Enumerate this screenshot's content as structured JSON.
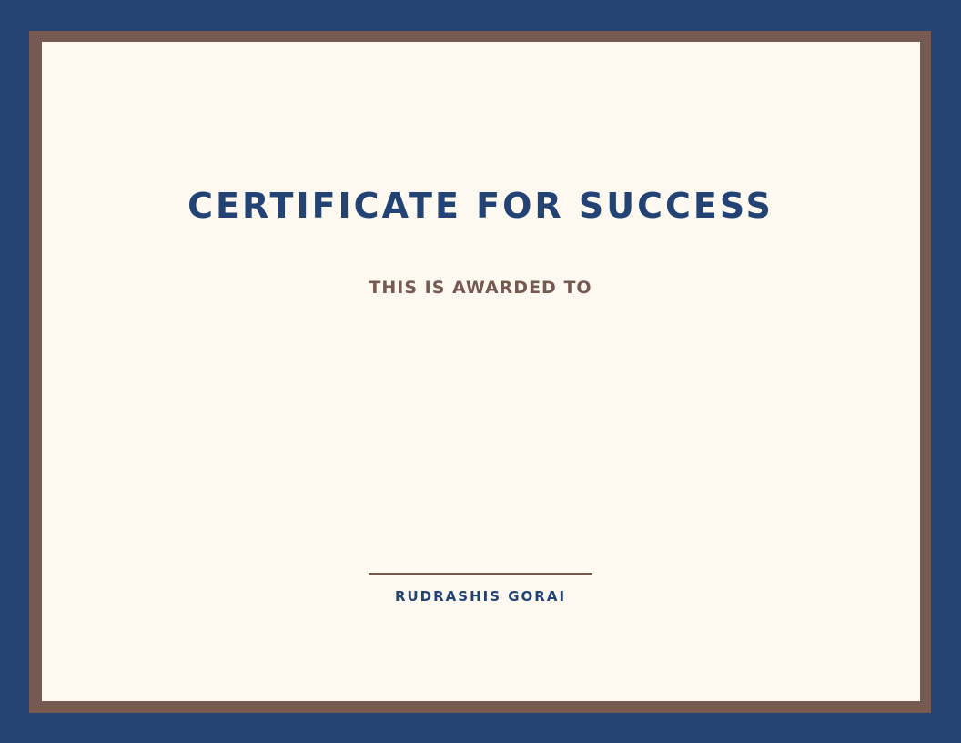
{
  "certificate": {
    "title": "CERTIFICATE FOR SUCCESS",
    "awarded_text": "THIS IS AWARDED TO",
    "signer_name": "RUDRASHIS GORAI"
  },
  "colors": {
    "navy": "#224373",
    "brown": "#765a51",
    "paper": "#fdf9f1"
  }
}
